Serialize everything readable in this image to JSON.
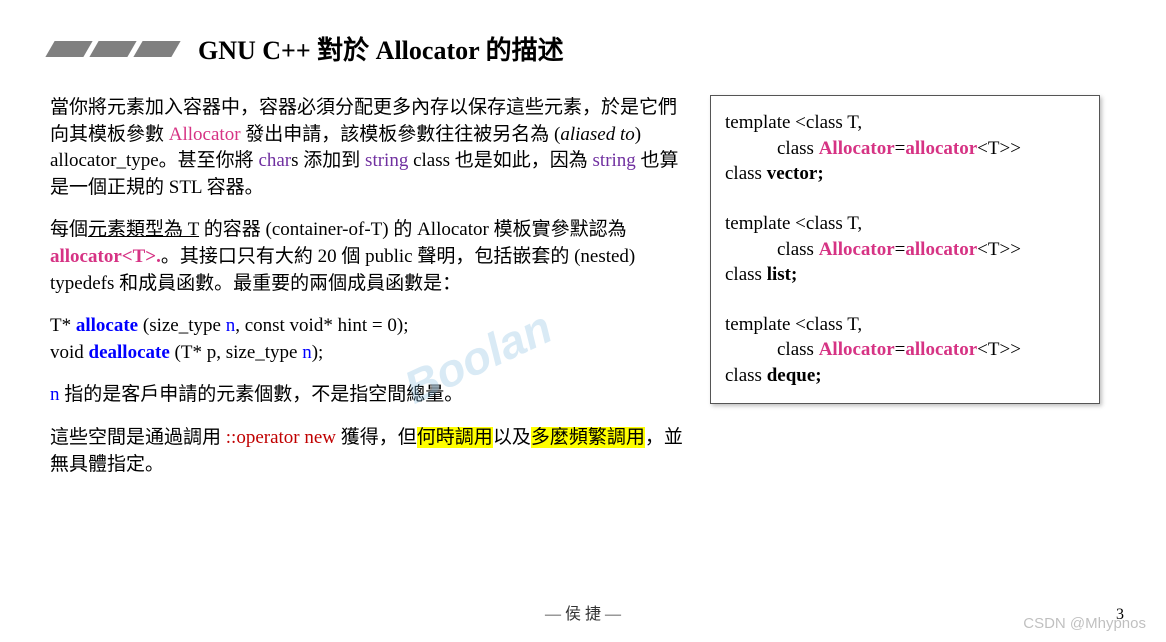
{
  "title": "GNU C++ 對於 Allocator 的描述",
  "left": {
    "p1a": "當你將元素加入容器中，容器必須分配更多內存以保存這些元素，於是它們向其模板參數 ",
    "p1b_alloc": "Allocator",
    "p1c": " 發出申請，該模板參數往往被另名為 (",
    "p1d_italic": "aliased to",
    "p1e": ") allocator_type。甚至你將 ",
    "p1f_char": "char",
    "p1g": "s 添加到 ",
    "p1h_string": "string",
    "p1i": " class 也是如此，因為 ",
    "p1j_string2": "string",
    "p1k": " 也算是一個正規的 STL 容器。",
    "p2a": "每個",
    "p2b_ul": "元素類型為 T",
    "p2c": " 的容器 (container-of-T) 的 Allocator 模板實參默認為 ",
    "p2d_allocT": "allocator<T>.",
    "p2e": "。其接口只有大約 20 個 public 聲明，包括嵌套的 (nested) typedefs 和成員函數。最重要的兩個成員函數是：",
    "sig1a": "T* ",
    "sig1b": "allocate",
    "sig1c": " (size_type ",
    "sig1d": "n",
    "sig1e": ", const void* hint = 0);",
    "sig2a": "void ",
    "sig2b": "deallocate",
    "sig2c": " (T* p, size_type ",
    "sig2d": "n",
    "sig2e": ");",
    "p3a": "n",
    "p3b": " 指的是客戶申請的元素個數，不是指空間總量。",
    "p4a": "這些空間是通過調用 ",
    "p4b_opnew": "::operator new",
    "p4c": " 獲得，但",
    "p4d_hl1": "何時調用",
    "p4e": "以及",
    "p4f_hl2": "多麼頻繁調用",
    "p4g": "，並無具體指定。"
  },
  "right": {
    "b1l1": "template <class T,",
    "b1l2a": "class ",
    "b1l2b": "Allocator",
    "b1l2c": "=",
    "b1l2d": "allocator",
    "b1l2e": "<T>>",
    "b1l3a": "class ",
    "b1l3b": "vector;",
    "b2l1": "template <class T,",
    "b2l2a": "class ",
    "b2l2b": "Allocator",
    "b2l2c": "=",
    "b2l2d": "allocator",
    "b2l2e": "<T>>",
    "b2l3a": "class ",
    "b2l3b": "list;",
    "b3l1": "template <class T,",
    "b3l2a": "class ",
    "b3l2b": "Allocator",
    "b3l2c": "=",
    "b3l2d": "allocator",
    "b3l2e": "<T>>",
    "b3l3a": "class ",
    "b3l3b": "deque;"
  },
  "footer": "— 侯 捷 —",
  "pagenum": "3",
  "csdn": "CSDN @Mhypnos",
  "boolan": "Boolan"
}
